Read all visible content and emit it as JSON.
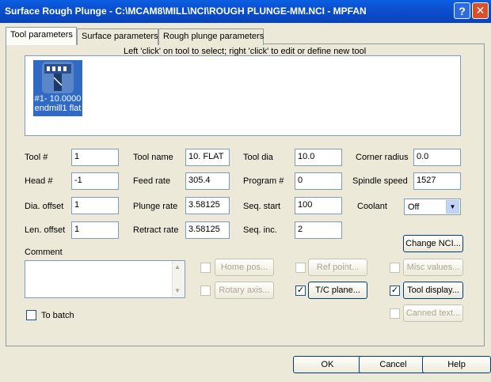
{
  "window": {
    "title": "Surface Rough Plunge - C:\\MCAM8\\MILL\\NCI\\ROUGH PLUNGE-MM.NCI - MPFAN",
    "help_glyph": "?",
    "close_glyph": "✕"
  },
  "tabs": [
    "Tool parameters",
    "Surface parameters",
    "Rough plunge parameters"
  ],
  "instruction": "Left 'click' on tool to select; right 'click' to edit or define new tool",
  "tool_tile": {
    "line1": "#1- 10.0000",
    "line2": "endmill1 flat"
  },
  "fields": {
    "tool_num": {
      "label": "Tool #",
      "value": "1"
    },
    "head_num": {
      "label": "Head #",
      "value": "-1"
    },
    "dia_offset": {
      "label": "Dia. offset",
      "value": "1"
    },
    "len_offset": {
      "label": "Len. offset",
      "value": "1"
    },
    "tool_name": {
      "label": "Tool name",
      "value": "10. FLAT"
    },
    "feed_rate": {
      "label": "Feed rate",
      "value": "305.4"
    },
    "plunge_rate": {
      "label": "Plunge rate",
      "value": "3.58125"
    },
    "retract_rate": {
      "label": "Retract rate",
      "value": "3.58125"
    },
    "tool_dia": {
      "label": "Tool dia",
      "value": "10.0"
    },
    "program_num": {
      "label": "Program #",
      "value": "0"
    },
    "seq_start": {
      "label": "Seq. start",
      "value": "100"
    },
    "seq_inc": {
      "label": "Seq. inc.",
      "value": "2"
    },
    "corner_radius": {
      "label": "Corner radius",
      "value": "0.0"
    },
    "spindle_speed": {
      "label": "Spindle speed",
      "value": "1527"
    },
    "coolant": {
      "label": "Coolant",
      "value": "Off"
    }
  },
  "comment_label": "Comment",
  "buttons": {
    "change_nci": "Change NCI...",
    "home_pos": "Home pos...",
    "ref_point": "Ref point...",
    "misc_values": "Misc values...",
    "rotary_axis": "Rotary axis...",
    "tc_plane": "T/C plane...",
    "tool_display": "Tool display...",
    "canned_text": "Canned text..."
  },
  "checks": {
    "checked_mark": "✓"
  },
  "to_batch_label": "To batch",
  "dialog_buttons": {
    "ok": "OK",
    "cancel": "Cancel",
    "help": "Help"
  }
}
